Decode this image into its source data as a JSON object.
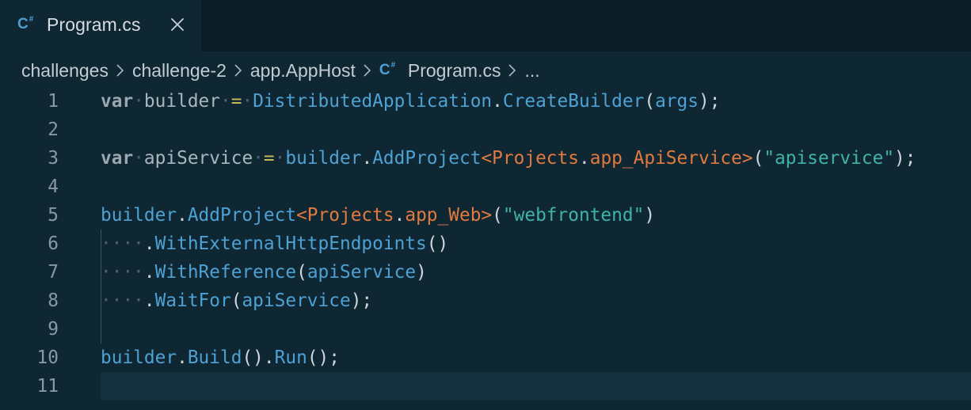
{
  "tab": {
    "icon": "csharp-file-icon",
    "label": "Program.cs",
    "close_icon": "close-icon"
  },
  "breadcrumb": {
    "items": [
      "challenges",
      "challenge-2",
      "app.AppHost",
      "Program.cs",
      "..."
    ],
    "file_icon": "csharp-file-icon",
    "separator_icon": "chevron-right-icon"
  },
  "editor": {
    "line_numbers": [
      "1",
      "2",
      "3",
      "4",
      "5",
      "6",
      "7",
      "8",
      "9",
      "10",
      "11"
    ],
    "current_line": "11",
    "code": {
      "l1": {
        "kw": "var",
        "name": "builder",
        "op": "=",
        "cls": "DistributedApplication",
        "fn": "CreateBuilder",
        "arg": "args",
        "end": ");"
      },
      "l3": {
        "kw": "var",
        "name": "apiService",
        "op": "=",
        "obj": "builder",
        "fn": "AddProject",
        "lt": "<",
        "ns": "Projects",
        "type": "app_ApiService",
        "gt": ">",
        "str": "\"apiservice\"",
        "end": ");"
      },
      "l5": {
        "obj": "builder",
        "fn": "AddProject",
        "lt": "<",
        "ns": "Projects",
        "type": "app_Web",
        "gt": ">",
        "str": "\"webfrontend\"",
        "end": ")"
      },
      "l6": {
        "fn": "WithExternalHttpEndpoints",
        "end": "()"
      },
      "l7": {
        "fn": "WithReference",
        "arg": "apiService",
        "end": ")"
      },
      "l8": {
        "fn": "WaitFor",
        "arg": "apiService",
        "end": ");"
      },
      "l10": {
        "obj": "builder",
        "fn1": "Build",
        "mid": "().",
        "fn2": "Run",
        "end": "();"
      }
    }
  },
  "colors": {
    "background": "#0f2733",
    "tabbar": "#0a1d26",
    "keyword": "#9aa7b0",
    "method": "#4ea1d3",
    "type": "#e07a3f",
    "string": "#3fb3a8",
    "operator": "#c8b855"
  }
}
